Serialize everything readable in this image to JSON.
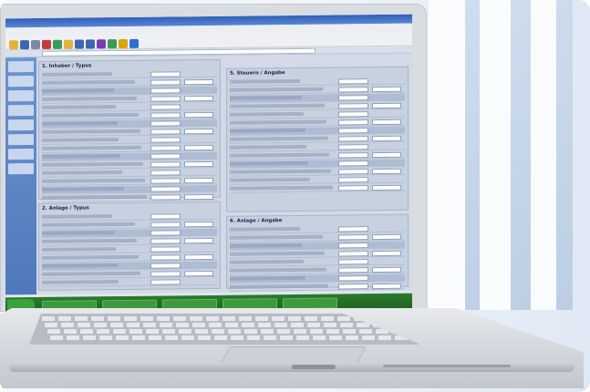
{
  "window": {
    "title": "",
    "menu": [
      "",
      "",
      "",
      "",
      "",
      ""
    ]
  },
  "toolbar": {
    "icons": [
      "folder-icon",
      "save-icon",
      "print-icon",
      "cut-icon",
      "copy-icon",
      "paste-icon",
      "undo-icon",
      "redo-icon",
      "calc-icon",
      "chart-icon",
      "help-icon",
      "globe-icon"
    ],
    "icon_colors": [
      "#e2b23a",
      "#3b67b4",
      "#7a8aa3",
      "#c23b3b",
      "#3b9a5a",
      "#e2b23a",
      "#3b67b4",
      "#3b67b4",
      "#7a3bb4",
      "#3b9a5a",
      "#d9a400",
      "#2f6fd1"
    ]
  },
  "form": {
    "left_sections": [
      {
        "id": "section-1",
        "title": "1. Inhaber / Typus",
        "rows": 16
      },
      {
        "id": "section-2",
        "title": "2. Anlage / Typus",
        "rows": 9
      }
    ],
    "right_sections": [
      {
        "id": "section-5",
        "title": "5. Steuern / Angabe",
        "rows": 14
      },
      {
        "id": "section-6",
        "title": "6. Anlage / Angabe",
        "rows": 8
      }
    ]
  },
  "taskbar": {
    "tasks": [
      "",
      "",
      "",
      "",
      ""
    ]
  },
  "colors": {
    "titlebar": "#2f5fb8",
    "form_bg": "#d3dae5",
    "taskbar": "#2c7a2c"
  }
}
